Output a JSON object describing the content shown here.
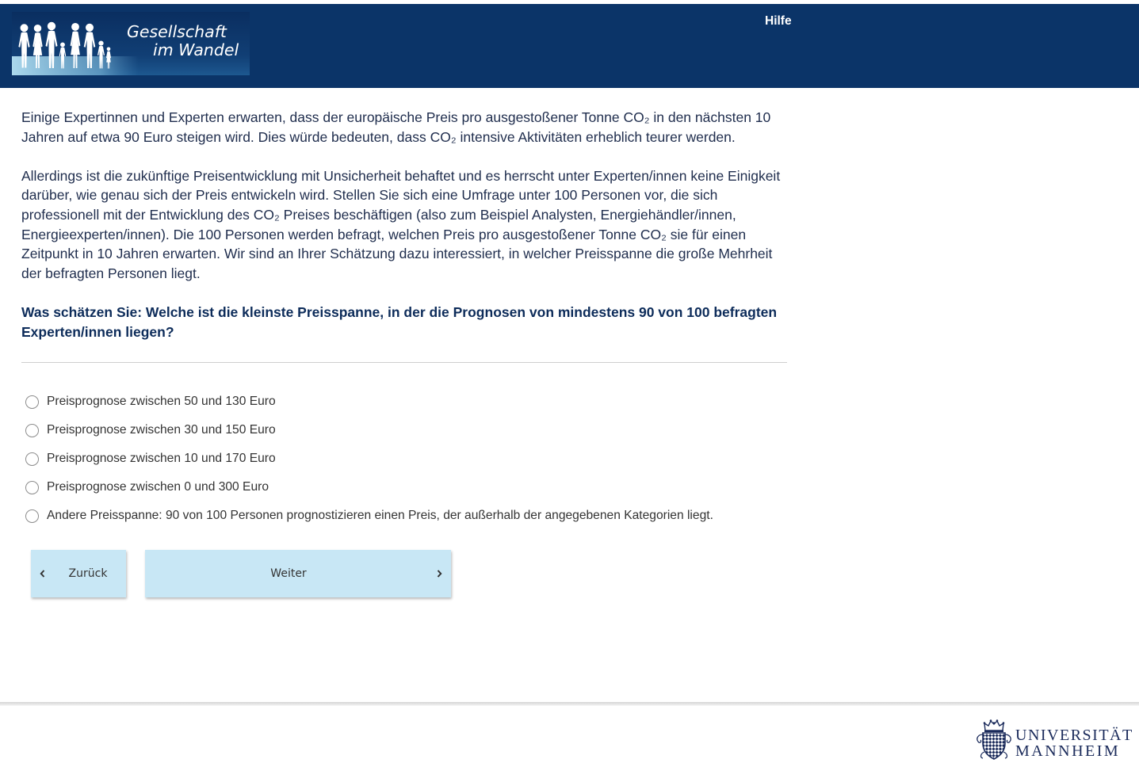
{
  "header": {
    "logo": {
      "line1": "Gesellschaft",
      "line2": "im Wandel"
    },
    "help_label": "Hilfe"
  },
  "intro": {
    "paragraph1": [
      "Einige Expertinnen und Experten erwarten, dass der europäische Preis pro ausgestoßener Tonne CO₂ in den nächsten 10",
      "Jahren auf etwa 90 Euro steigen wird. Dies würde bedeuten, dass CO₂ intensive Aktivitäten erheblich teurer werden."
    ],
    "paragraph2": [
      "Allerdings ist die zukünftige Preisentwicklung mit Unsicherheit behaftet und es herrscht unter Experten/innen keine Einigkeit",
      "darüber, wie genau sich der Preis entwickeln wird. Stellen Sie sich eine Umfrage unter 100 Personen vor, die sich",
      "professionell mit der Entwicklung des CO₂ Preises beschäftigen (also zum Beispiel Analysten, Energiehändler/innen,",
      "Energieexperten/innen). Die 100 Personen werden befragt, welchen Preis pro ausgestoßener Tonne CO₂ sie für einen",
      "Zeitpunkt in 10 Jahren erwarten. Wir sind an Ihrer Schätzung dazu interessiert, in welcher Preisspanne die große Mehrheit",
      "der befragten Personen liegt."
    ]
  },
  "question": {
    "lines": [
      "Was schätzen Sie: Welche ist die kleinste Preisspanne, in der die Prognosen von mindestens 90 von 100 befragten",
      "Experten/innen liegen?"
    ]
  },
  "options": [
    {
      "label": "Preisprognose zwischen 50 und 130 Euro",
      "selected": false
    },
    {
      "label": "Preisprognose zwischen 30 und 150 Euro",
      "selected": false
    },
    {
      "label": "Preisprognose zwischen 10 und 170 Euro",
      "selected": false
    },
    {
      "label": "Preisprognose zwischen 0 und 300 Euro",
      "selected": false
    },
    {
      "label": "Andere Preisspanne: 90 von 100 Personen prognostizieren einen Preis, der außerhalb der angegebenen Kategorien liegt.",
      "selected": false
    }
  ],
  "nav": {
    "back_label": "Zurück",
    "back_icon": "chevron-left-icon",
    "next_label": "Weiter",
    "next_icon": "chevron-right-icon"
  },
  "footer": {
    "university_logo": {
      "line1": "UNIVERSITÄT",
      "line2": "MANNHEIM"
    }
  },
  "colors": {
    "header_bg": "#0b3468",
    "button_bg": "#c8e7f5",
    "body_text": "#1f2d4d",
    "question_text": "#0d2c5a",
    "university_navy": "#1b2b5b"
  }
}
